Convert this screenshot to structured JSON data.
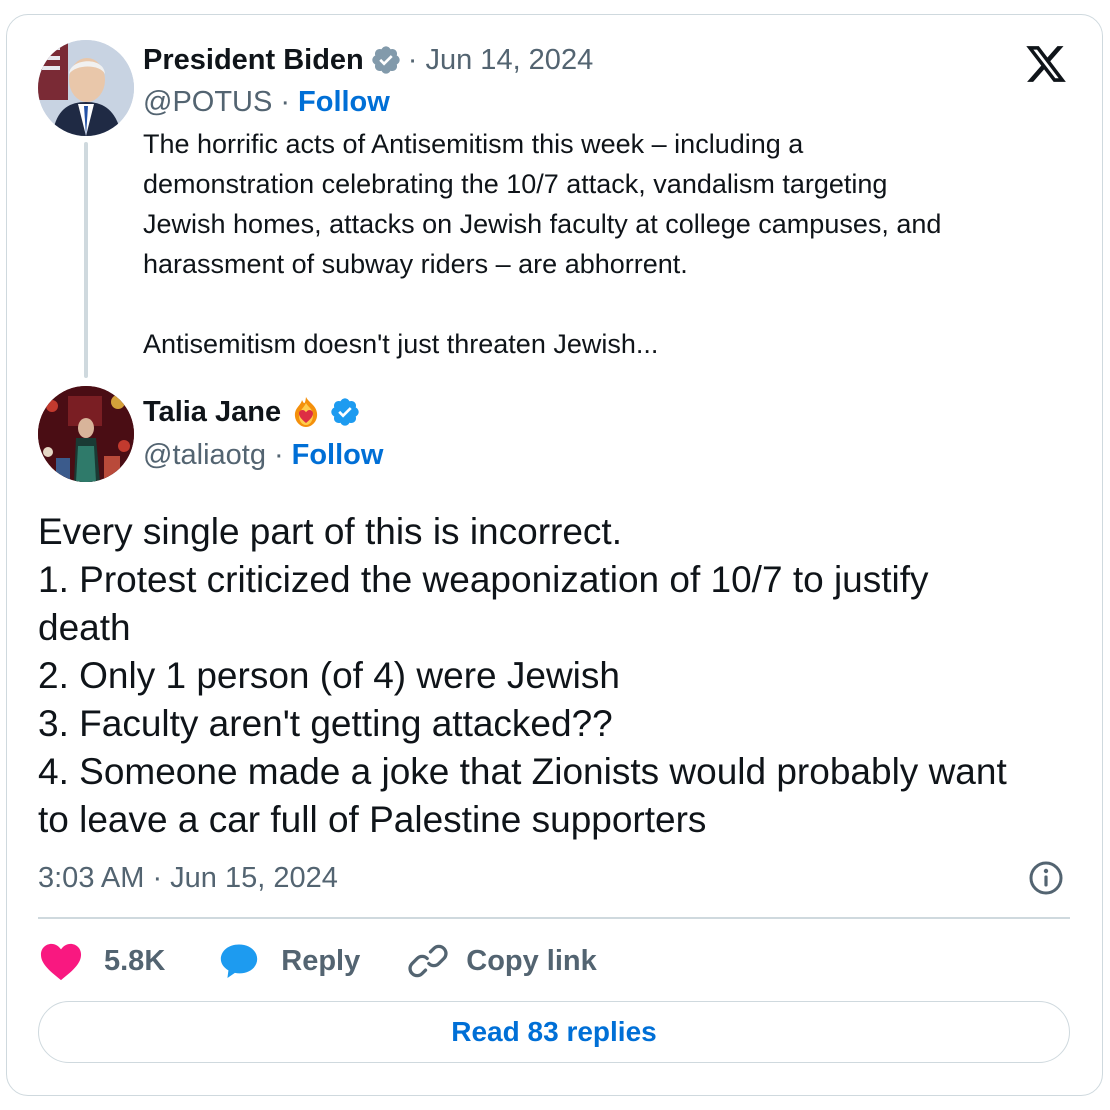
{
  "quoted_tweet": {
    "display_name": "President Biden",
    "handle": "@POTUS",
    "separator": "·",
    "date": "· Jun 14, 2024",
    "follow_label": "Follow",
    "text_lines": [
      "The horrific acts of Antisemitism this week – including a",
      "demonstration celebrating the 10/7 attack, vandalism targeting",
      "Jewish homes, attacks on Jewish faculty at college campuses, and",
      "harassment of subway riders – are abhorrent."
    ],
    "text_truncated": "Antisemitism doesn't just threaten Jewish..."
  },
  "tweet": {
    "display_name": "Talia Jane",
    "handle": "@taliaotg",
    "separator": "·",
    "follow_label": "Follow",
    "text_lines": [
      "Every single part of this is incorrect.",
      "1. Protest criticized the weaponization of 10/7 to justify",
      "death",
      "2. Only 1 person (of 4) were Jewish",
      "3. Faculty aren't getting attacked??",
      "4. Someone made a joke that Zionists would probably want",
      "to leave a car full of Palestine supporters"
    ],
    "timestamp": "3:03 AM · Jun 15, 2024"
  },
  "actions": {
    "like_count": "5.8K",
    "reply_label": "Reply",
    "copy_link_label": "Copy link"
  },
  "read_replies_label": "Read 83 replies",
  "icons": {
    "logo": "x-logo",
    "verified_gray": "verified-badge-gray",
    "verified_blue": "verified-badge-blue",
    "emoji": "fire-heart-emoji",
    "info": "info-icon",
    "like": "heart-icon",
    "reply": "speech-bubble-icon",
    "copy": "link-icon"
  },
  "colors": {
    "link_blue": "#006fd6",
    "verified_blue": "#1d9bf0",
    "verified_gray": "#829aab",
    "like_pink": "#f91880",
    "muted_text": "#536471",
    "border": "#cfd9de"
  }
}
